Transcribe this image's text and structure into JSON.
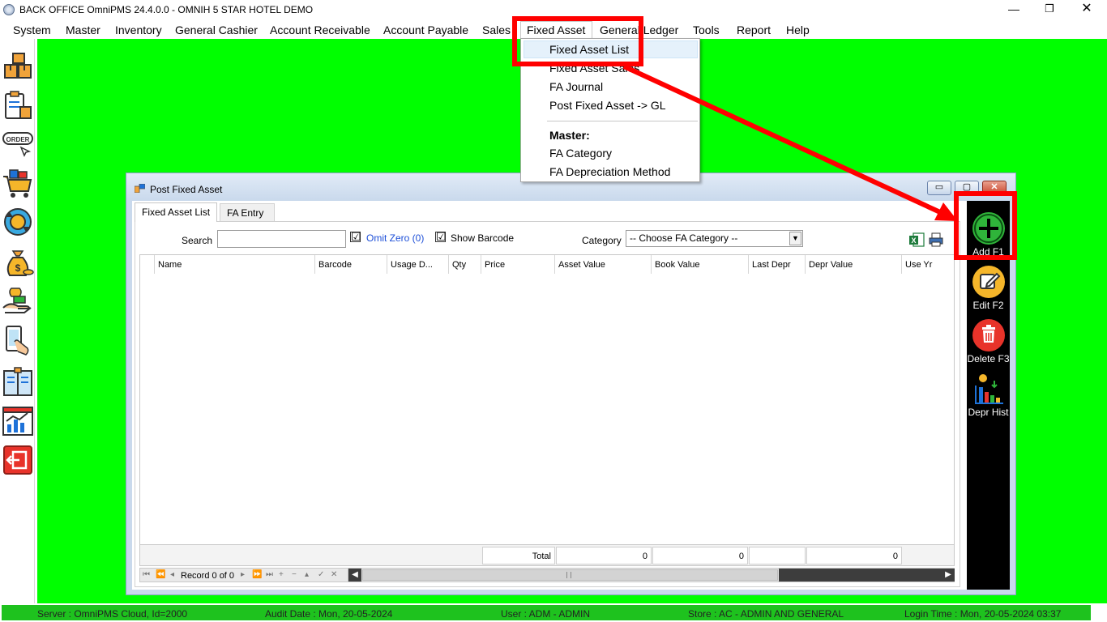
{
  "window": {
    "title": "BACK OFFICE OmniPMS 24.4.0.0 - OMNIH 5 STAR HOTEL DEMO",
    "minimize": "—",
    "maximize": "❐",
    "close": "✕"
  },
  "menubar": {
    "items": [
      "System",
      "Master",
      "Inventory",
      "General Cashier",
      "Account Receivable",
      "Account Payable",
      "Sales",
      "Fixed Asset",
      "General Ledger",
      "Tools",
      "Report",
      "Help"
    ]
  },
  "dropdown": {
    "items": [
      "Fixed Asset List",
      "Fixed Asset Sales",
      "FA Journal",
      "Post Fixed Asset -> GL"
    ],
    "section_header": "Master:",
    "master_items": [
      "FA Category",
      "FA Depreciation Method"
    ]
  },
  "sidebar": {
    "icons": [
      "boxes-icon",
      "clipboard-icon",
      "order-icon",
      "cart-icon",
      "sync-icon",
      "money-bag-icon",
      "hand-money-icon",
      "phone-touch-icon",
      "ledger-icon",
      "chart-icon",
      "exit-icon"
    ],
    "order_label": "ORDER"
  },
  "child_window": {
    "title": "Post Fixed Asset",
    "min": "▭",
    "max": "▢",
    "close": "✕",
    "tabs": [
      "Fixed Asset List",
      "FA Entry"
    ],
    "search_label": "Search",
    "search_value": "",
    "omit_zero_label": "Omit Zero (0)",
    "omit_zero_checked": "☑",
    "show_barcode_label": "Show Barcode",
    "show_barcode_checked": "☑",
    "category_label": "Category",
    "category_value": "-- Choose FA Category --",
    "columns": [
      "Name",
      "Barcode",
      "Usage D...",
      "Qty",
      "Price",
      "Asset Value",
      "Book Value",
      "Last Depr",
      "Depr Value",
      "Use Yr"
    ],
    "footer": {
      "total_label": "Total",
      "asset_value_total": "0",
      "book_value_total": "0",
      "depr_value_total": "0"
    },
    "navigator": {
      "record_text": "Record 0 of 0"
    },
    "actions": [
      {
        "label": "Add F1",
        "color": "#2fb43a"
      },
      {
        "label": "Edit F2",
        "color": "#f5b62a"
      },
      {
        "label": "Delete F3",
        "color": "#e8332a"
      },
      {
        "label": "Depr Hist",
        "color": "#1e72d8"
      }
    ]
  },
  "statusbar": {
    "server": "Server : OmniPMS Cloud, Id=2000",
    "audit_date": "Audit Date : Mon, 20-05-2024",
    "user": "User : ADM - ADMIN",
    "store": "Store : AC - ADMIN AND GENERAL",
    "login_time": "Login Time : Mon, 20-05-2024 03:37"
  },
  "colors": {
    "desktop": "#00ff00",
    "statusbar": "#1ec21e",
    "annotation": "#ff0000"
  }
}
